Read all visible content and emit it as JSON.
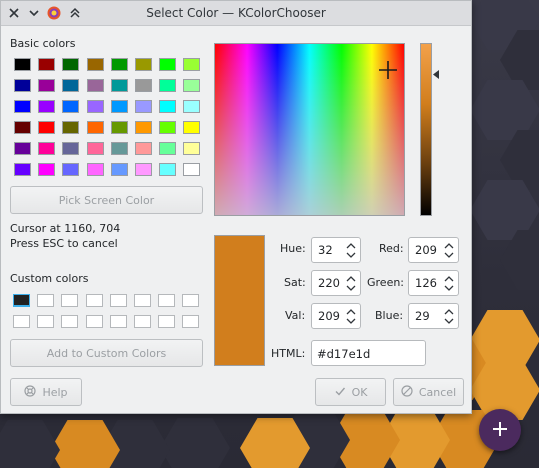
{
  "window": {
    "title": "Select Color — KColorChooser"
  },
  "basic_colors": {
    "label": "Basic colors",
    "swatches": [
      [
        "#000000",
        "#990000",
        "#006600",
        "#996600",
        "#009900",
        "#999900",
        "#00ff00",
        "#99ff33"
      ],
      [
        "#000099",
        "#990099",
        "#006699",
        "#996699",
        "#009999",
        "#999999",
        "#00ff99",
        "#99ff99"
      ],
      [
        "#0000ff",
        "#9900ff",
        "#0066ff",
        "#9966ff",
        "#0099ff",
        "#9999ff",
        "#00ffff",
        "#99ffff"
      ],
      [
        "#660000",
        "#ff0000",
        "#666600",
        "#ff6600",
        "#669900",
        "#ff9900",
        "#66ff00",
        "#ffff00"
      ],
      [
        "#660099",
        "#ff0099",
        "#666699",
        "#ff6699",
        "#669999",
        "#ff9999",
        "#66ff99",
        "#ffff99"
      ],
      [
        "#6600ff",
        "#ff00ff",
        "#6666ff",
        "#ff66ff",
        "#6699ff",
        "#ff99ff",
        "#66ffff",
        "#ffffff"
      ]
    ]
  },
  "pick_screen_button": "Pick Screen Color",
  "cursor_info": "Cursor at 1160, 704",
  "esc_info": "Press ESC to cancel",
  "custom_colors": {
    "label": "Custom colors",
    "swatches": [
      "#222222",
      "#ffffff",
      "#ffffff",
      "#ffffff",
      "#ffffff",
      "#ffffff",
      "#ffffff",
      "#ffffff",
      "#ffffff",
      "#ffffff",
      "#ffffff",
      "#ffffff",
      "#ffffff",
      "#ffffff",
      "#ffffff",
      "#ffffff"
    ]
  },
  "add_custom_button": "Add to Custom Colors",
  "fields": {
    "hue_label": "Hue:",
    "hue": "32",
    "sat_label": "Sat:",
    "sat": "220",
    "val_label": "Val:",
    "val": "209",
    "red_label": "Red:",
    "red": "209",
    "green_label": "Green:",
    "green": "126",
    "blue_label": "Blue:",
    "blue": "29",
    "html_label": "HTML:",
    "html": "#d17e1d"
  },
  "selected_color": "#d17e1d",
  "buttons": {
    "help": "Help",
    "ok": "OK",
    "cancel": "Cancel"
  },
  "accent_colors": {
    "fab": "#4b2a5e",
    "desktop_hex_orange": "#e39a2e"
  }
}
